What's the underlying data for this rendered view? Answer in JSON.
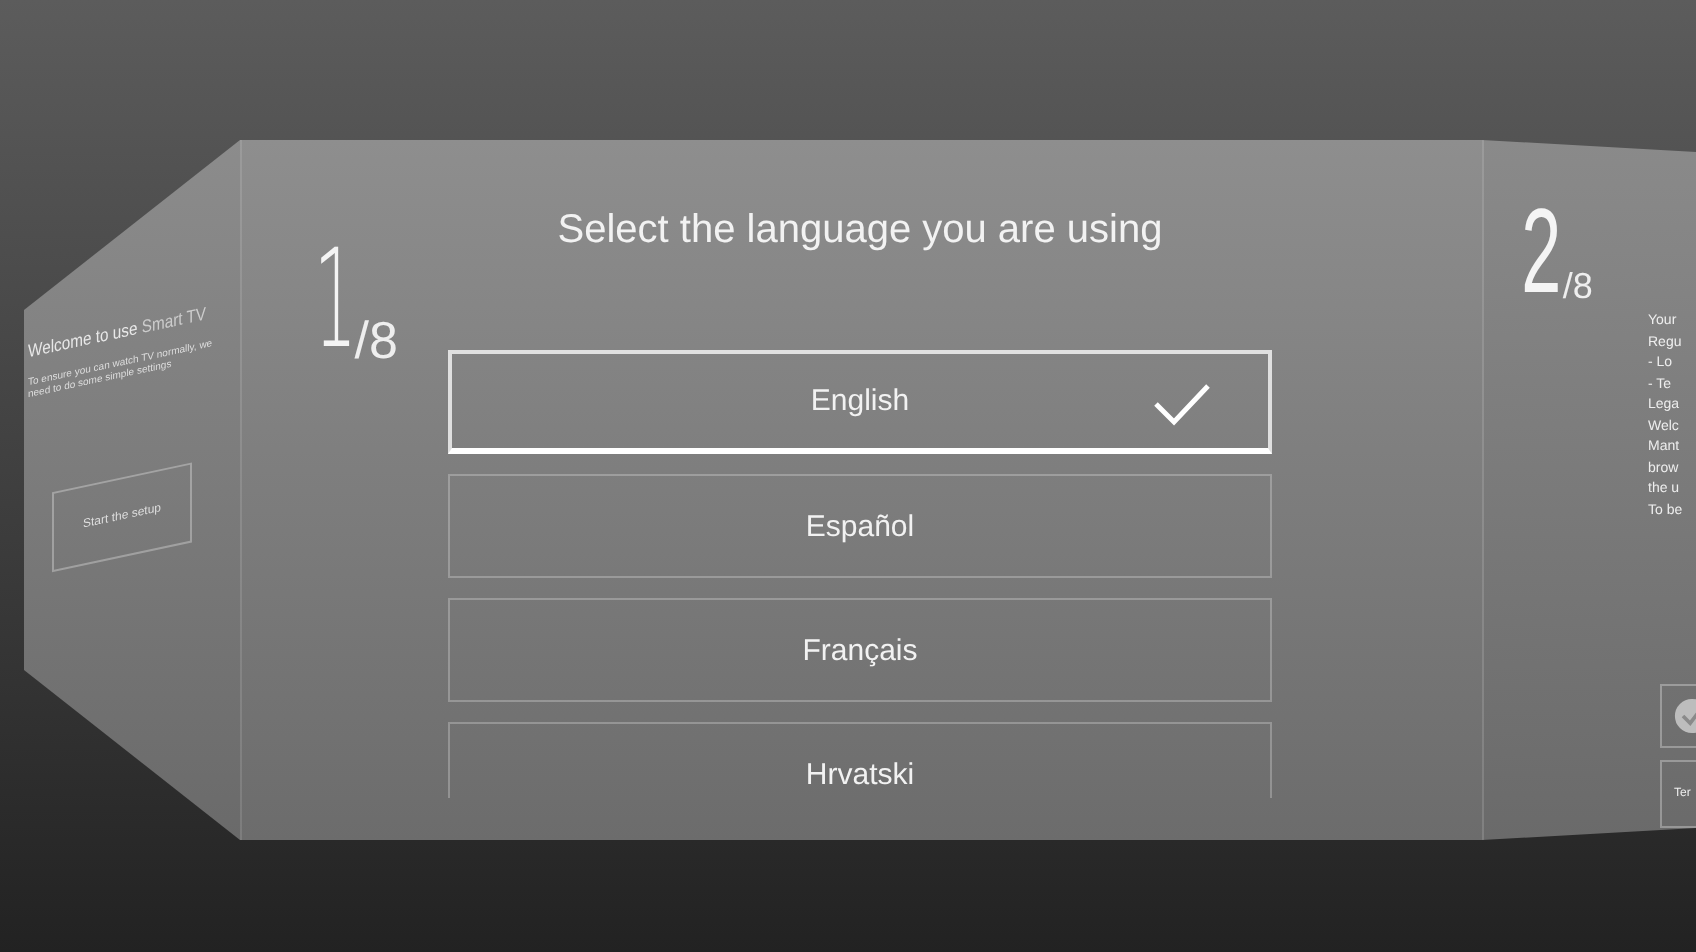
{
  "previous_step": {
    "title": "Welcome to use **Smart TV**",
    "subtitle": "To ensure you can watch TV normally, we need to do some simple settings",
    "button": "Start the setup"
  },
  "current_step": {
    "number": "1",
    "total": "/8",
    "title": "Select the language you are using",
    "languages": [
      {
        "label": "English",
        "selected": true
      },
      {
        "label": "Español",
        "selected": false
      },
      {
        "label": "Français",
        "selected": false
      },
      {
        "label": "Hrvatski",
        "selected": false
      }
    ]
  },
  "next_step": {
    "number": "2",
    "total": "/8",
    "text_lines": [
      "Your",
      "Regu",
      "- Lo",
      "- Te",
      "Lega",
      "Welc",
      "Mant",
      "brow",
      "the u",
      "To be"
    ],
    "agree_checked": true,
    "button": "Ter"
  }
}
